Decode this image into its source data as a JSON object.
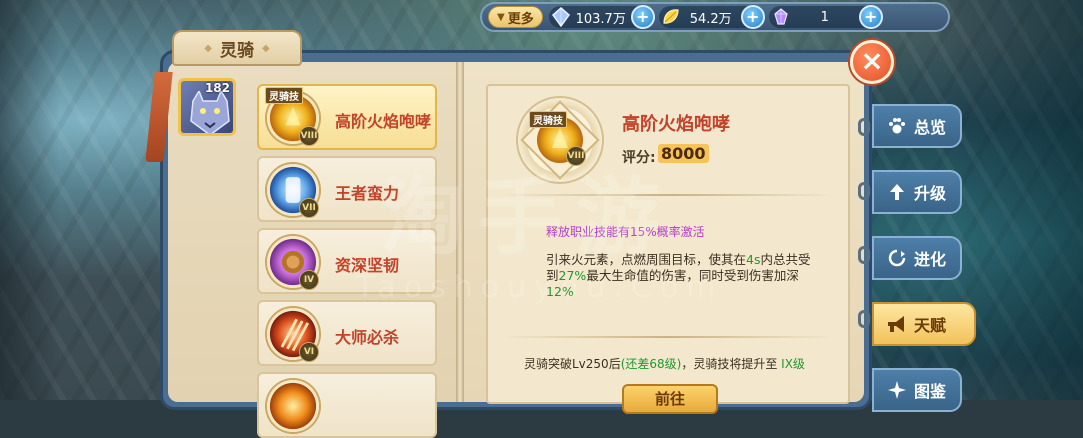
{
  "topbar": {
    "more_label": "更多",
    "currencies": [
      {
        "icon": "crystal-icon",
        "value": "103.7万"
      },
      {
        "icon": "gold-leaf-icon",
        "value": "54.2万"
      },
      {
        "icon": "purple-gem-icon",
        "value": "1"
      }
    ],
    "plus_label": "+"
  },
  "panel": {
    "title": "灵骑"
  },
  "avatar": {
    "count": "182"
  },
  "skills": [
    {
      "tag": "灵骑技",
      "name": "高阶火焰咆哮",
      "rank": "VIII",
      "active": true
    },
    {
      "tag": "",
      "name": "王者蛮力",
      "rank": "VII",
      "active": false
    },
    {
      "tag": "",
      "name": "资深坚韧",
      "rank": "IV",
      "active": false
    },
    {
      "tag": "",
      "name": "大师必杀",
      "rank": "VI",
      "active": false
    }
  ],
  "detail": {
    "tag": "灵骑技",
    "rank": "VIII",
    "name": "高阶火焰咆哮",
    "score_label": "评分:",
    "score_value": "8000",
    "trigger": "释放职业技能有15%概率激活",
    "desc_part1": "引来火元素，点燃周围目标，使其在",
    "desc_g1": "4s",
    "desc_part2": "内总共受到",
    "desc_g2": "27%",
    "desc_part3": "最大生命值的伤害，同时受到伤害加深",
    "desc_g3": "12%",
    "break_part1": "灵骑突破Lv250后",
    "break_g": "(还差68级)",
    "break_part2": "，灵骑技将提升至 ",
    "break_g2": "IX级",
    "goto_label": "前往"
  },
  "close_label": "×",
  "side_tabs": [
    {
      "label": "总览",
      "icon": "paw-icon"
    },
    {
      "label": "升级",
      "icon": "upgrade-icon"
    },
    {
      "label": "进化",
      "icon": "evolve-icon"
    },
    {
      "label": "天赋",
      "icon": "horn-icon",
      "active": true
    },
    {
      "label": "图鉴",
      "icon": "star-icon"
    }
  ],
  "watermark": {
    "main": "淘手游",
    "sub": "Taoshouyou.Com"
  },
  "colors": {
    "accent_red": "#c3432a",
    "green": "#1f9a2c",
    "purple": "#b13fc8",
    "gold": "#f2c25b"
  }
}
